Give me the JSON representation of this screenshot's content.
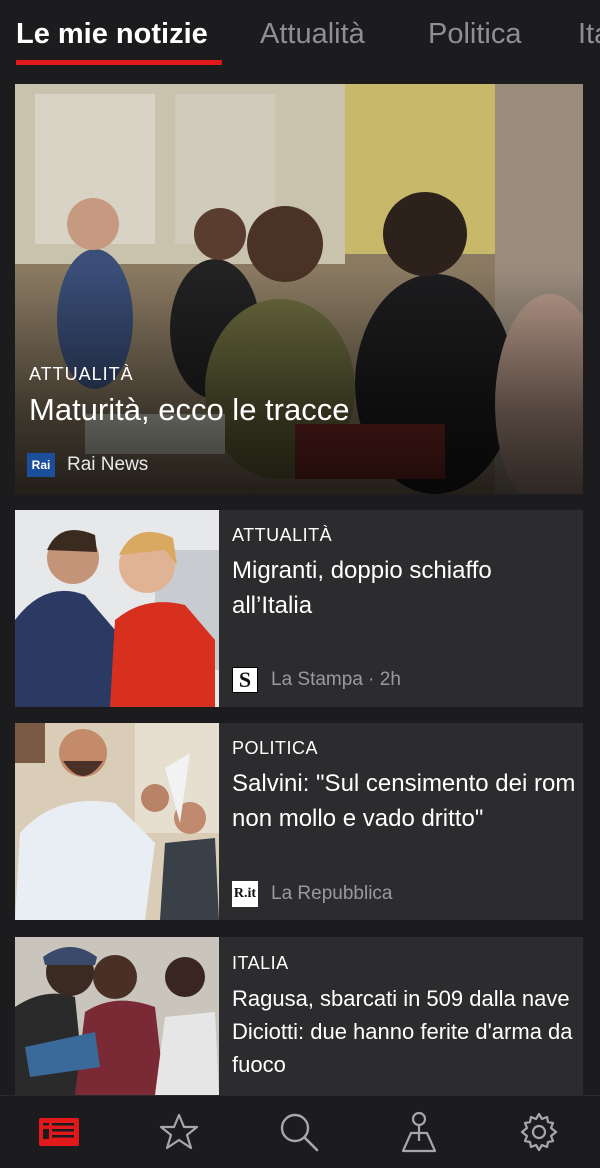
{
  "tabs": [
    {
      "label": "Le mie notizie",
      "active": true
    },
    {
      "label": "Attualità",
      "active": false
    },
    {
      "label": "Politica",
      "active": false
    },
    {
      "label": "Ita",
      "active": false
    }
  ],
  "hero": {
    "category": "ATTUALITÀ",
    "title": "Maturità, ecco le tracce",
    "source_logo": "Rai",
    "source": "Rai News"
  },
  "articles": [
    {
      "category": "ATTUALITÀ",
      "title": "Migranti, doppio schiaffo all’Italia",
      "source_logo": "S",
      "source": "La Stampa · 2h"
    },
    {
      "category": "POLITICA",
      "title": "Salvini: \"Sul censimento dei rom non mollo e vado dritto\"",
      "source_logo": "R.it",
      "source": "La Repubblica"
    },
    {
      "category": "ITALIA",
      "title": "Ragusa, sbarcati in 509 dalla nave Diciotti: due hanno ferite d'arma da fuoco"
    }
  ],
  "bottom_nav": [
    {
      "icon": "news-icon",
      "active": true
    },
    {
      "icon": "star-icon",
      "active": false
    },
    {
      "icon": "search-icon",
      "active": false
    },
    {
      "icon": "map-pin-icon",
      "active": false
    },
    {
      "icon": "gear-icon",
      "active": false
    }
  ],
  "colors": {
    "accent": "#e2191b",
    "background": "#1c1c1e",
    "card": "#2c2c2e"
  }
}
